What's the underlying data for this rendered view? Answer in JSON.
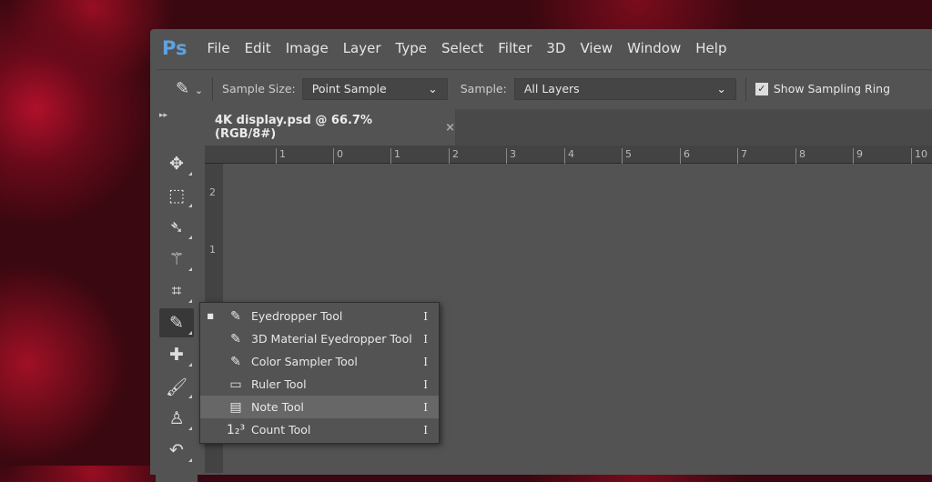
{
  "app": {
    "logo": "Ps",
    "menu": [
      "File",
      "Edit",
      "Image",
      "Layer",
      "Type",
      "Select",
      "Filter",
      "3D",
      "View",
      "Window",
      "Help"
    ]
  },
  "options": {
    "sample_size_label": "Sample Size:",
    "sample_size_value": "Point Sample",
    "sample_label": "Sample:",
    "sample_value": "All Layers",
    "show_ring_label": "Show Sampling Ring",
    "show_ring_checked": true
  },
  "document": {
    "tab_title": "4K display.psd @ 66.7% (RGB/8#)",
    "close": "×"
  },
  "rulers": {
    "horizontal": [
      "1",
      "0",
      "1",
      "2",
      "3",
      "4",
      "5",
      "6",
      "7",
      "8",
      "9",
      "10"
    ],
    "vertical": [
      "2",
      "1"
    ]
  },
  "flyout": {
    "items": [
      {
        "label": "Eyedropper Tool",
        "shortcut": "I",
        "selected": true,
        "icon": "✎"
      },
      {
        "label": "3D Material Eyedropper Tool",
        "shortcut": "I",
        "icon": "✎"
      },
      {
        "label": "Color Sampler Tool",
        "shortcut": "I",
        "icon": "✎"
      },
      {
        "label": "Ruler Tool",
        "shortcut": "I",
        "icon": "▭"
      },
      {
        "label": "Note Tool",
        "shortcut": "I",
        "icon": "▤"
      },
      {
        "label": "Count Tool",
        "shortcut": "I",
        "icon": "1₂³"
      }
    ]
  }
}
